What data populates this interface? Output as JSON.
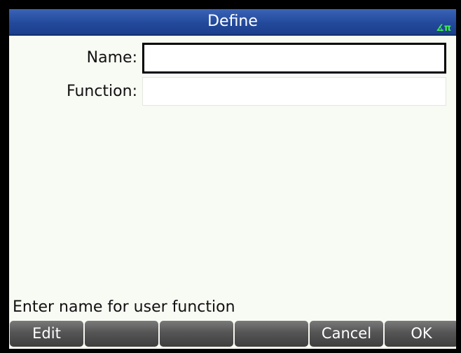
{
  "header": {
    "title": "Define",
    "angle_mode_icon": "angle-pi-icon",
    "angle_mode_text": "∡π"
  },
  "form": {
    "name_label": "Name:",
    "name_value": "",
    "function_label": "Function:",
    "function_value": ""
  },
  "status": {
    "prompt": "Enter name for user function"
  },
  "softkeys": [
    {
      "label": "Edit"
    },
    {
      "label": ""
    },
    {
      "label": ""
    },
    {
      "label": ""
    },
    {
      "label": "Cancel"
    },
    {
      "label": "OK"
    }
  ],
  "colors": {
    "title_bar": "#23499b",
    "angle_indicator": "#3df24f",
    "softkey": "#555555"
  }
}
